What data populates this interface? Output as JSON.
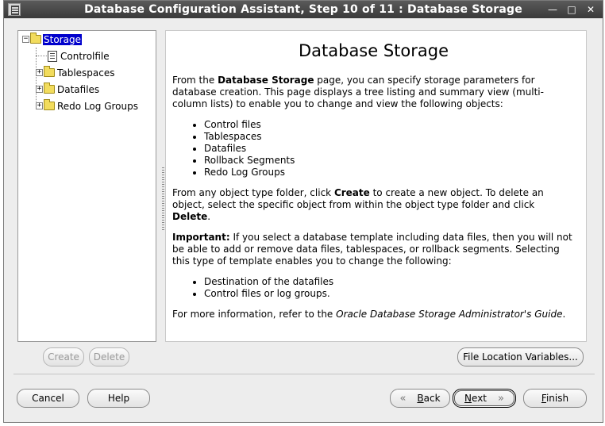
{
  "window": {
    "title": "Database Configuration Assistant, Step 10 of 11 : Database Storage",
    "controls": {
      "minimize": "—",
      "maximize": "□",
      "close": "✕"
    }
  },
  "tree": {
    "root": {
      "label": "Storage",
      "expander": "−"
    },
    "children": [
      {
        "label": "Controlfile",
        "icon": "file-icon"
      },
      {
        "label": "Tablespaces",
        "icon": "folder-icon",
        "expander": "+"
      },
      {
        "label": "Datafiles",
        "icon": "folder-icon",
        "expander": "+"
      },
      {
        "label": "Redo Log Groups",
        "icon": "folder-icon",
        "expander": "+"
      }
    ]
  },
  "content": {
    "title": "Database Storage",
    "p1": {
      "pre": "From the ",
      "bold": "Database Storage",
      "post": " page, you can specify storage parameters for database creation. This page displays a tree listing and summary view (multi-column lists) to enable you to change and view the following objects:"
    },
    "list1": [
      "Control files",
      "Tablespaces",
      "Datafiles",
      "Rollback Segments",
      "Redo Log Groups"
    ],
    "p2": {
      "a": "From any object type folder, click ",
      "b1": "Create",
      "c": " to create a new object. To delete an object, select the specific object from within the object type folder and click ",
      "b2": "Delete",
      "d": "."
    },
    "p3": {
      "bold": "Important:",
      "text": " If you select a database template including data files, then you will not be able to add or remove data files, tablespaces, or rollback segments. Selecting this type of template enables you to change the following:"
    },
    "list2": [
      "Destination of the datafiles",
      "Control files or log groups."
    ],
    "p4": {
      "pre": "For more information, refer to the ",
      "italic": "Oracle Database Storage Administrator's Guide",
      "post": "."
    }
  },
  "buttons": {
    "create": "Create",
    "delete": "Delete",
    "file_location": "File Location Variables...",
    "cancel": "Cancel",
    "help": "Help",
    "back": {
      "mnemonic": "B",
      "rest": "ack",
      "arrow": "«"
    },
    "next": {
      "mnemonic": "N",
      "rest": "ext",
      "arrow": "»"
    },
    "finish": {
      "mnemonic": "F",
      "rest": "inish"
    }
  }
}
